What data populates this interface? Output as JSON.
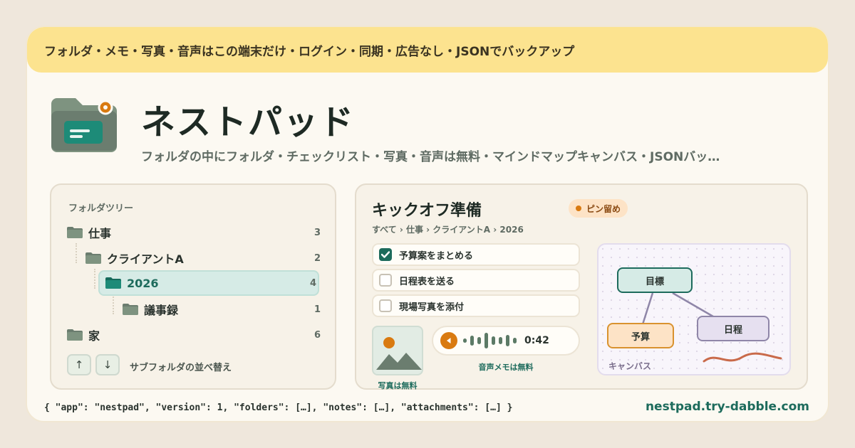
{
  "banner": {
    "text": "フォルダ・メモ・写真・音声はこの端末だけ・ログイン・同期・広告なし・JSONでバックアップ"
  },
  "app": {
    "title": "ネストパッド",
    "subtitle": "フォルダの中にフォルダ・チェックリスト・写真・音声は無料・マインドマップキャンバス・JSONバッ…",
    "icon": "folder-app-icon"
  },
  "tree": {
    "heading": "フォルダツリー",
    "items": [
      {
        "label": "仕事",
        "count": "3",
        "depth": 0
      },
      {
        "label": "クライアントA",
        "count": "2",
        "depth": 1
      },
      {
        "label": "2026",
        "count": "4",
        "depth": 2,
        "selected": true
      },
      {
        "label": "議事録",
        "count": "1",
        "depth": 3
      },
      {
        "label": "家",
        "count": "6",
        "depth": 0
      }
    ],
    "sort_up": "↑",
    "sort_down": "↓",
    "sort_label": "サブフォルダの並べ替え"
  },
  "note": {
    "title": "キックオフ準備",
    "pin_label": "ピン留め",
    "breadcrumb": "すべて › 仕事 › クライアントA › 2026",
    "checklist": [
      {
        "label": "予算案をまとめる",
        "checked": true
      },
      {
        "label": "日程表を送る",
        "checked": false
      },
      {
        "label": "現場写真を添付",
        "checked": false
      }
    ],
    "photo_label": "写真は無料",
    "audio": {
      "time": "0:42",
      "label": "音声メモは無料"
    },
    "canvas": {
      "label": "キャンバス",
      "nodes": [
        "目標",
        "予算",
        "日程"
      ]
    }
  },
  "footer": {
    "json": "{ \"app\": \"nestpad\", \"version\": 1, \"folders\": […], \"notes\": […], \"attachments\": […] }",
    "domain": "nestpad.try-dabble.com"
  },
  "colors": {
    "accent": "#1d6b5c",
    "banner": "#fce38f",
    "pin": "#d97a10",
    "folder": "#6b7d6f"
  }
}
